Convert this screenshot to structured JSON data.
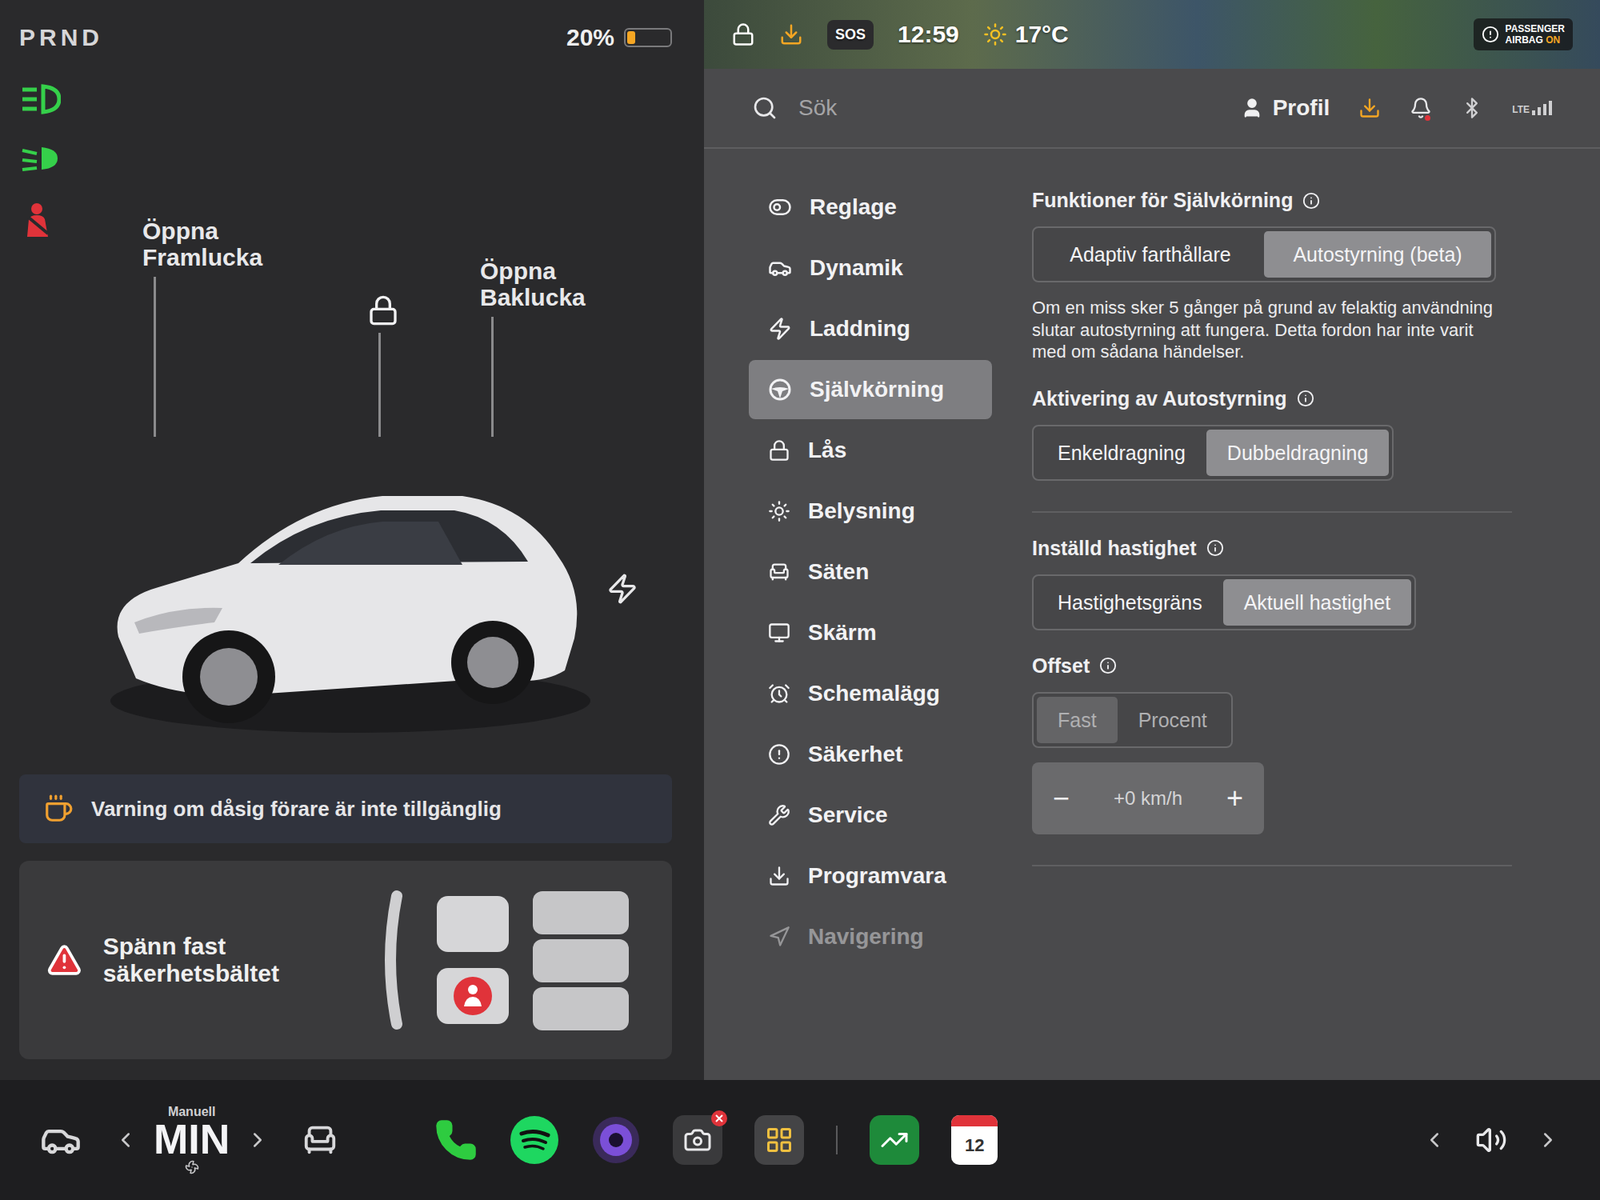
{
  "drive": {
    "gears": "PRND",
    "battery": {
      "reading": "20%",
      "level": 0.2
    }
  },
  "indicators": [
    {
      "kind": "headlight",
      "color": "#35d04a"
    },
    {
      "kind": "beam",
      "color": "#35d04a"
    },
    {
      "kind": "seatbelt",
      "color": "#e0333a"
    }
  ],
  "car": {
    "frunk": "Öppna Framlucka",
    "trunk": "Öppna Baklucka"
  },
  "alerts": [
    {
      "kind": "notice",
      "text": "Varning om dåsig förare är inte tillgänglig"
    },
    {
      "kind": "warning",
      "text": "Spänn fast säkerhetsbältet"
    }
  ],
  "status": {
    "sos": "SOS",
    "time": "12:59",
    "temperature": "17°C",
    "airbag": {
      "line1": "PASSENGER",
      "line2": "AIRBAG",
      "state": "ON"
    }
  },
  "search": {
    "placeholder": "Sök"
  },
  "profile": "Profil",
  "network": "LTE",
  "sidebar": {
    "items": [
      {
        "label": "Reglage",
        "selected": false,
        "faded": false
      },
      {
        "label": "Dynamik",
        "selected": false,
        "faded": false
      },
      {
        "label": "Laddning",
        "selected": false,
        "faded": false
      },
      {
        "label": "Självkörning",
        "selected": true,
        "faded": false
      },
      {
        "label": "Lås",
        "selected": false,
        "faded": false
      },
      {
        "label": "Belysning",
        "selected": false,
        "faded": false
      },
      {
        "label": "Säten",
        "selected": false,
        "faded": false
      },
      {
        "label": "Skärm",
        "selected": false,
        "faded": false
      },
      {
        "label": "Schemalägg",
        "selected": false,
        "faded": false
      },
      {
        "label": "Säkerhet",
        "selected": false,
        "faded": false
      },
      {
        "label": "Service",
        "selected": false,
        "faded": false
      },
      {
        "label": "Programvara",
        "selected": false,
        "faded": false
      },
      {
        "label": "Navigering",
        "selected": false,
        "faded": true
      }
    ]
  },
  "sections": [
    {
      "title": "Funktioner för Självkörning",
      "options": [
        {
          "label": "Adaptiv farthållare",
          "selected": false,
          "disabled": false
        },
        {
          "label": "Autostyrning (beta)",
          "selected": true,
          "disabled": false
        }
      ],
      "note": "Om en miss sker 5 gånger på grund av felaktig användning slutar autostyrning att fungera. Detta fordon har inte varit med om sådana händelser."
    },
    {
      "title": "Aktivering av Autostyrning",
      "options": [
        {
          "label": "Enkeldragning",
          "selected": false,
          "disabled": false
        },
        {
          "label": "Dubbeldragning",
          "selected": true,
          "disabled": false
        }
      ]
    },
    {
      "title": "Inställd hastighet",
      "options": [
        {
          "label": "Hastighetsgräns",
          "selected": false,
          "disabled": false
        },
        {
          "label": "Aktuell hastighet",
          "selected": true,
          "disabled": false
        }
      ]
    },
    {
      "title": "Offset",
      "options": [
        {
          "label": "Fast",
          "selected": true,
          "disabled": true
        },
        {
          "label": "Procent",
          "selected": false,
          "disabled": true
        }
      ],
      "stepper": {
        "minus": "−",
        "value": "+0 km/h",
        "plus": "+",
        "disabled": true
      }
    }
  ],
  "dock": {
    "climate": {
      "mode": "Manuell",
      "value": "MIN"
    },
    "calendar_day": "12"
  }
}
